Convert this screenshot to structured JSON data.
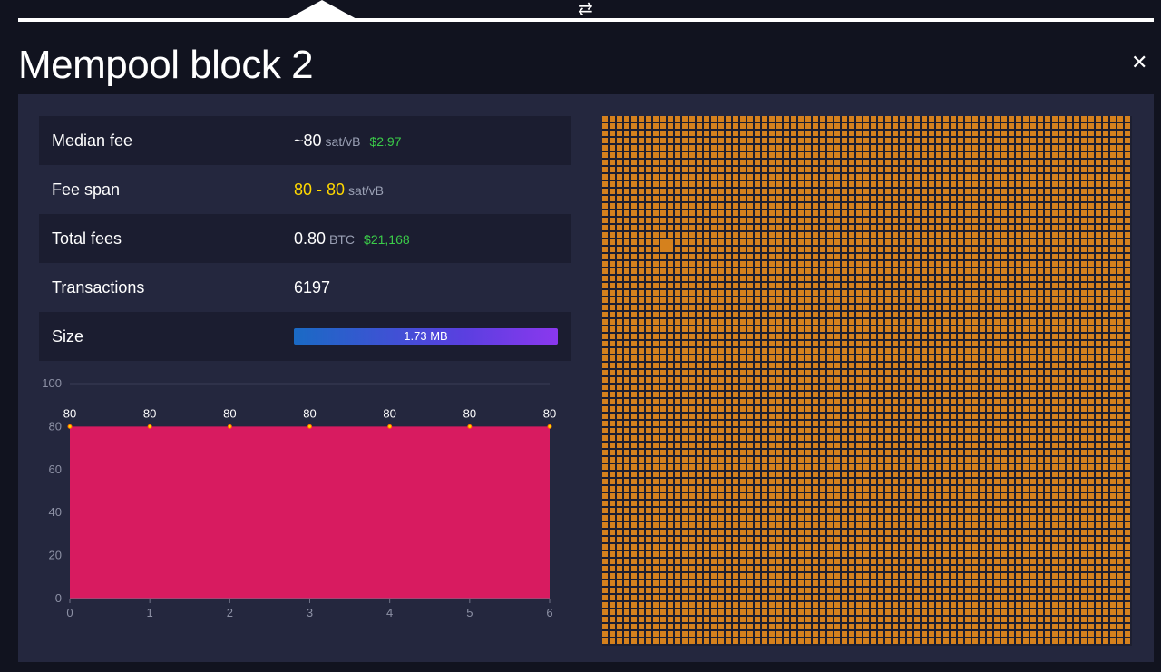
{
  "header": {
    "swap_icon": "swap-arrows-icon",
    "title": "Mempool block 2",
    "close_icon": "close-icon"
  },
  "colors": {
    "background": "#11131f",
    "panel": "#24273e",
    "row_dark": "#1b1d30",
    "usd": "#3bcc49",
    "fee_span": "#ffd800",
    "area_fill": "#d81b60",
    "tx_square": "#d5811d",
    "grid_bg": "#1d1f31"
  },
  "stats": {
    "median_fee": {
      "label": "Median fee",
      "value": "~80",
      "unit": "sat/vB",
      "usd": "$2.97"
    },
    "fee_span": {
      "label": "Fee span",
      "value": "80 - 80",
      "unit": "sat/vB"
    },
    "total_fees": {
      "label": "Total fees",
      "value": "0.80",
      "unit": "BTC",
      "usd": "$21,168"
    },
    "transactions": {
      "label": "Transactions",
      "value": "6197"
    },
    "size": {
      "label": "Size",
      "value": "1.73 MB"
    }
  },
  "chart_data": {
    "type": "area",
    "x": [
      0,
      1,
      2,
      3,
      4,
      5,
      6
    ],
    "series": [
      {
        "values": [
          80,
          80,
          80,
          80,
          80,
          80,
          80
        ]
      }
    ],
    "data_labels": [
      "80",
      "80",
      "80",
      "80",
      "80",
      "80",
      "80"
    ],
    "ylim": [
      0,
      100
    ],
    "yticks": [
      0,
      20,
      40,
      60,
      80,
      100
    ],
    "xticks": [
      0,
      1,
      2,
      3,
      4,
      5,
      6
    ],
    "grid": true
  }
}
